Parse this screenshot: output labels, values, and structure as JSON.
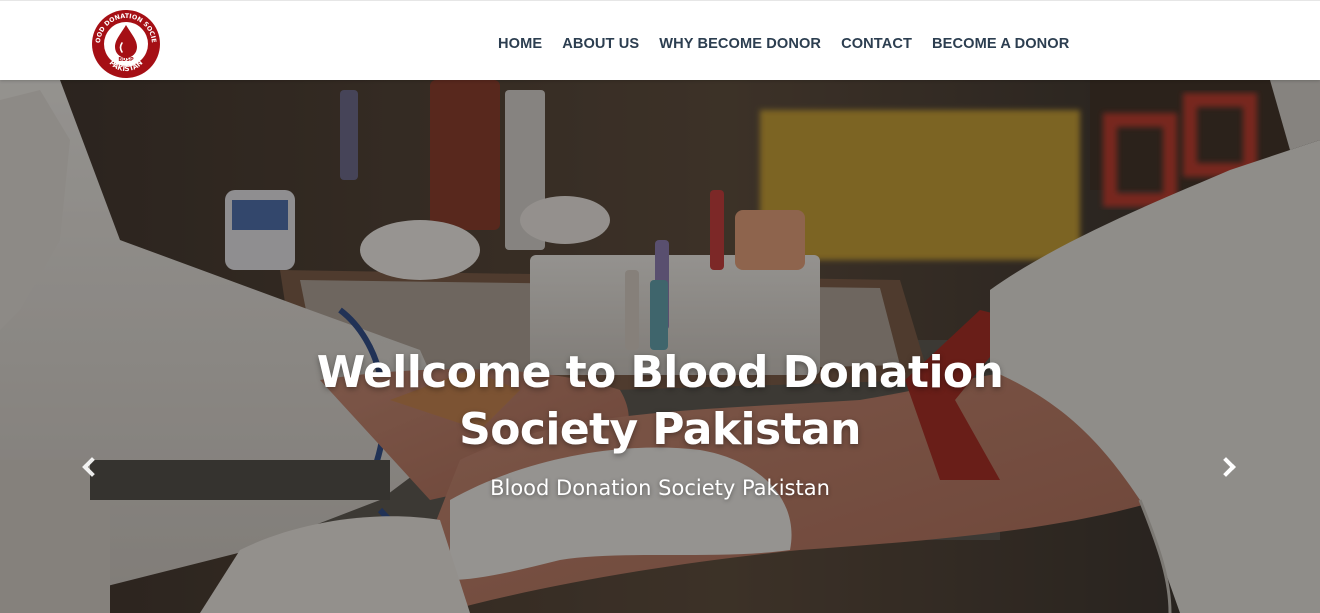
{
  "brand": {
    "logo_alt": "Blood Donation Society Pakistan logo",
    "logo_ring_text": "BLOOD DONATION SOCIETY",
    "logo_bottom_text": "PAKISTAN",
    "logo_center_text": "BDSP",
    "colors": {
      "primary_red": "#a50f15",
      "nav_text": "#2c3e50"
    }
  },
  "nav": {
    "items": [
      {
        "label": "HOME"
      },
      {
        "label": "ABOUT US"
      },
      {
        "label": "WHY BECOME DONOR"
      },
      {
        "label": "CONTACT"
      },
      {
        "label": "BECOME A DONOR"
      }
    ]
  },
  "hero": {
    "title_line1": "Wellcome to Blood Donation",
    "title_line2": "Society Pakistan",
    "subtitle": "Blood Donation Society Pakistan",
    "background_description_icon": "blood-donation-photo",
    "prev_icon": "chevron-left-icon",
    "next_icon": "chevron-right-icon"
  }
}
